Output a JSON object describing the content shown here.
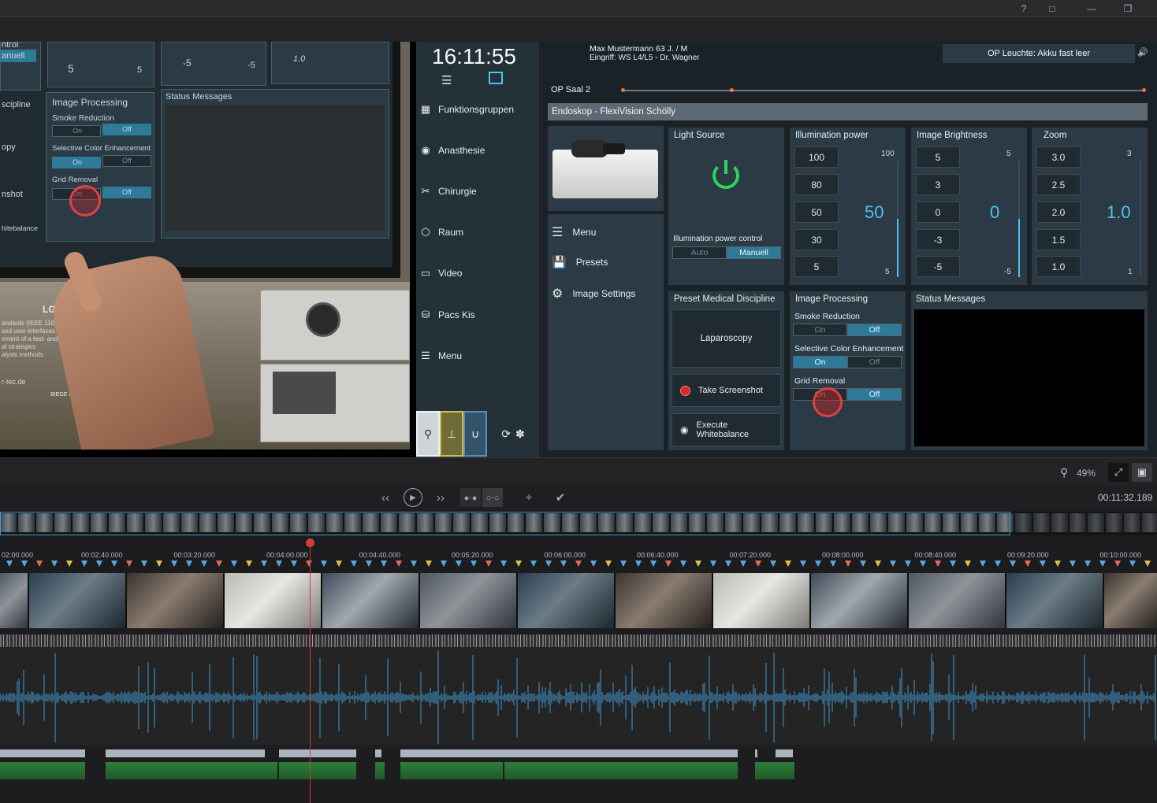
{
  "titlebar": {
    "icons": [
      "help-icon",
      "feedback-icon",
      "minimize-icon",
      "maximize-icon"
    ]
  },
  "video": {
    "mon_left_items": [
      "ntrol",
      "anuell",
      "scipline",
      "opy",
      "nshot",
      "hitebalance"
    ],
    "mon_nums": [
      "5",
      "5",
      "-5",
      "-5",
      "1.0"
    ],
    "mon_image_processing": "Image Processing",
    "mon_smoke": "Smoke Reduction",
    "mon_on": "On",
    "mon_off": "Off",
    "mon_sce": "Selective Color Enhancement",
    "mon_grid": "Grid Removal",
    "mon_status": "Status Messages",
    "brand_text": "LG",
    "poster_lines": [
      "andards (IEEE 11073 S",
      "sed user-interfaces",
      "ement of a test- and de",
      "al strategies",
      "alysis methods"
    ],
    "poster_url": "r-tec.de",
    "poster_brand": "BIEGE DE ROR"
  },
  "orui": {
    "clock": "16:11:55",
    "patient": "Max Mustermann 63 J. / M",
    "procedure": "Eingriff: WS L4/L5 - Dr. Wagner",
    "alert": "OP Leuchte: Akku fast leer",
    "room": "OP Saal 2",
    "device_title": "Endoskop - FlexiVision Schölly",
    "nav": [
      {
        "label": "Funktionsgruppen",
        "icon": "grid-icon"
      },
      {
        "label": "Anasthesie",
        "icon": "anesthesia-icon"
      },
      {
        "label": "Chirurgie",
        "icon": "scissors-icon"
      },
      {
        "label": "Raum",
        "icon": "room-icon"
      },
      {
        "label": "Video",
        "icon": "monitor-icon"
      },
      {
        "label": "Pacs Kis",
        "icon": "database-icon"
      },
      {
        "label": "Menu",
        "icon": "menu-icon"
      }
    ],
    "submenu": [
      {
        "label": "Menu",
        "icon": "menu-icon"
      },
      {
        "label": "Presets",
        "icon": "save-icon"
      },
      {
        "label": "Image Settings",
        "icon": "gear-icon"
      }
    ],
    "light_source": {
      "title": "Light Source",
      "ctrl_label": "Illumination power control",
      "auto": "Auto",
      "manual": "Manuell"
    },
    "illumination": {
      "title": "Illumination power",
      "buttons": [
        "100",
        "80",
        "50",
        "30",
        "5"
      ],
      "max": "100",
      "min": "5",
      "value": "50",
      "level": 0.5
    },
    "brightness": {
      "title": "Image Brightness",
      "buttons": [
        "5",
        "3",
        "0",
        "-3",
        "-5"
      ],
      "max": "5",
      "min": "-5",
      "value": "0",
      "level": 0.5
    },
    "zoom": {
      "title": "Zoom",
      "buttons": [
        "3.0",
        "2.5",
        "2.0",
        "1.5",
        "1.0"
      ],
      "max": "3",
      "min": "1",
      "value": "1.0",
      "level": 0.0
    },
    "preset": {
      "title": "Preset Medical Discipline",
      "discipline": "Laparoscopy",
      "screenshot": "Take Screenshot",
      "whitebalance": "Execute Whitebalance"
    },
    "image_processing": {
      "title": "Image Processing",
      "smoke": "Smoke Reduction",
      "sce": "Selective Color Enhancement",
      "grid": "Grid Removal",
      "on": "On",
      "off": "Off"
    },
    "status": {
      "title": "Status Messages"
    }
  },
  "editor": {
    "zoom": "49%",
    "timecode": "00:11:32.189",
    "ruler": [
      "02:00.000",
      "00:02:40.000",
      "00:03:20.000",
      "00:04:00.000",
      "00:04:40.000",
      "00:05:20.000",
      "00:06:00.000",
      "00:06:40.000",
      "00:07:20.000",
      "00:08:00.000",
      "00:08:40.000",
      "00:09:20.000",
      "00:10:00.000"
    ]
  },
  "colors": {
    "accent": "#4fc3ef",
    "power_green": "#2fd35a",
    "record_red": "#d22a2a",
    "marker_blue": "#5aa7dc"
  }
}
